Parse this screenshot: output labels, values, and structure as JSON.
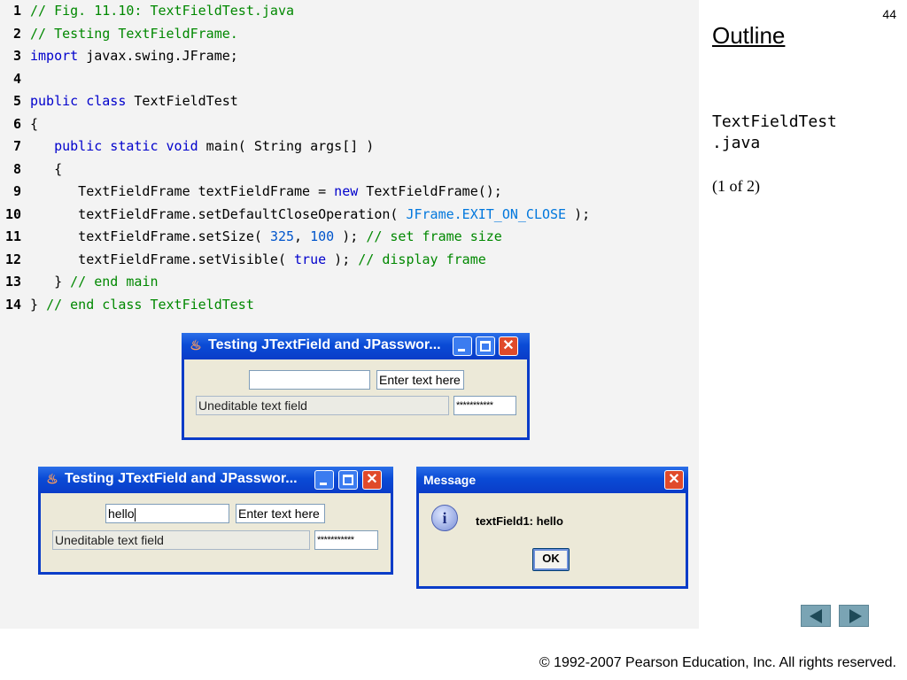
{
  "slide": {
    "number": "44"
  },
  "outline": {
    "title": "Outline",
    "filename": "TextFieldTest\n.java",
    "page": "(1 of 2)"
  },
  "code": [
    {
      "n": "1",
      "parts": [
        {
          "t": "cm",
          "s": "// Fig. 11.10: TextFieldTest.java"
        }
      ]
    },
    {
      "n": "2",
      "parts": [
        {
          "t": "cm",
          "s": "// Testing TextFieldFrame."
        }
      ]
    },
    {
      "n": "3",
      "parts": [
        {
          "t": "kw",
          "s": "import"
        },
        {
          "t": "",
          "s": " javax.swing.JFrame;"
        }
      ]
    },
    {
      "n": "4",
      "parts": []
    },
    {
      "n": "5",
      "parts": [
        {
          "t": "kw",
          "s": "public class"
        },
        {
          "t": "",
          "s": " TextFieldTest"
        }
      ]
    },
    {
      "n": "6",
      "parts": [
        {
          "t": "",
          "s": "{"
        }
      ]
    },
    {
      "n": "7",
      "parts": [
        {
          "t": "",
          "s": "   "
        },
        {
          "t": "kw",
          "s": "public static void"
        },
        {
          "t": "",
          "s": " main( String args[] )"
        }
      ]
    },
    {
      "n": "8",
      "parts": [
        {
          "t": "",
          "s": "   {"
        }
      ]
    },
    {
      "n": "9",
      "parts": [
        {
          "t": "",
          "s": "      TextFieldFrame textFieldFrame = "
        },
        {
          "t": "kw",
          "s": "new"
        },
        {
          "t": "",
          "s": " TextFieldFrame();"
        }
      ]
    },
    {
      "n": "10",
      "parts": [
        {
          "t": "",
          "s": "      textFieldFrame.setDefaultCloseOperation( "
        },
        {
          "t": "cst",
          "s": "JFrame.EXIT_ON_CLOSE"
        },
        {
          "t": "",
          "s": " );"
        }
      ]
    },
    {
      "n": "11",
      "parts": [
        {
          "t": "",
          "s": "      textFieldFrame.setSize( "
        },
        {
          "t": "num",
          "s": "325"
        },
        {
          "t": "",
          "s": ", "
        },
        {
          "t": "num",
          "s": "100"
        },
        {
          "t": "",
          "s": " ); "
        },
        {
          "t": "cm",
          "s": "// set frame size"
        }
      ]
    },
    {
      "n": "12",
      "parts": [
        {
          "t": "",
          "s": "      textFieldFrame.setVisible( "
        },
        {
          "t": "kw",
          "s": "true"
        },
        {
          "t": "",
          "s": " ); "
        },
        {
          "t": "cm",
          "s": "// display frame"
        }
      ]
    },
    {
      "n": "13",
      "parts": [
        {
          "t": "",
          "s": "   } "
        },
        {
          "t": "cm",
          "s": "// end main"
        }
      ]
    },
    {
      "n": "14",
      "parts": [
        {
          "t": "",
          "s": "} "
        },
        {
          "t": "cm",
          "s": "// end class TextFieldTest"
        }
      ]
    }
  ],
  "window1": {
    "title": "Testing JTextField and JPasswor...",
    "field1": "",
    "field2": "Enter text here",
    "field3": "Uneditable text field",
    "password": "***********"
  },
  "window2": {
    "title": "Testing JTextField and JPasswor...",
    "field1": "hello",
    "field2": "Enter text here",
    "field3": "Uneditable text field",
    "password": "***********"
  },
  "message": {
    "title": "Message",
    "icon_letter": "i",
    "text": "textField1: hello",
    "ok_label": "OK"
  },
  "navigation": {
    "prev_icon": "triangle-left-icon",
    "next_icon": "triangle-right-icon"
  },
  "footer": {
    "copyright": "© 1992-2007 Pearson Education, Inc.  All rights reserved."
  }
}
